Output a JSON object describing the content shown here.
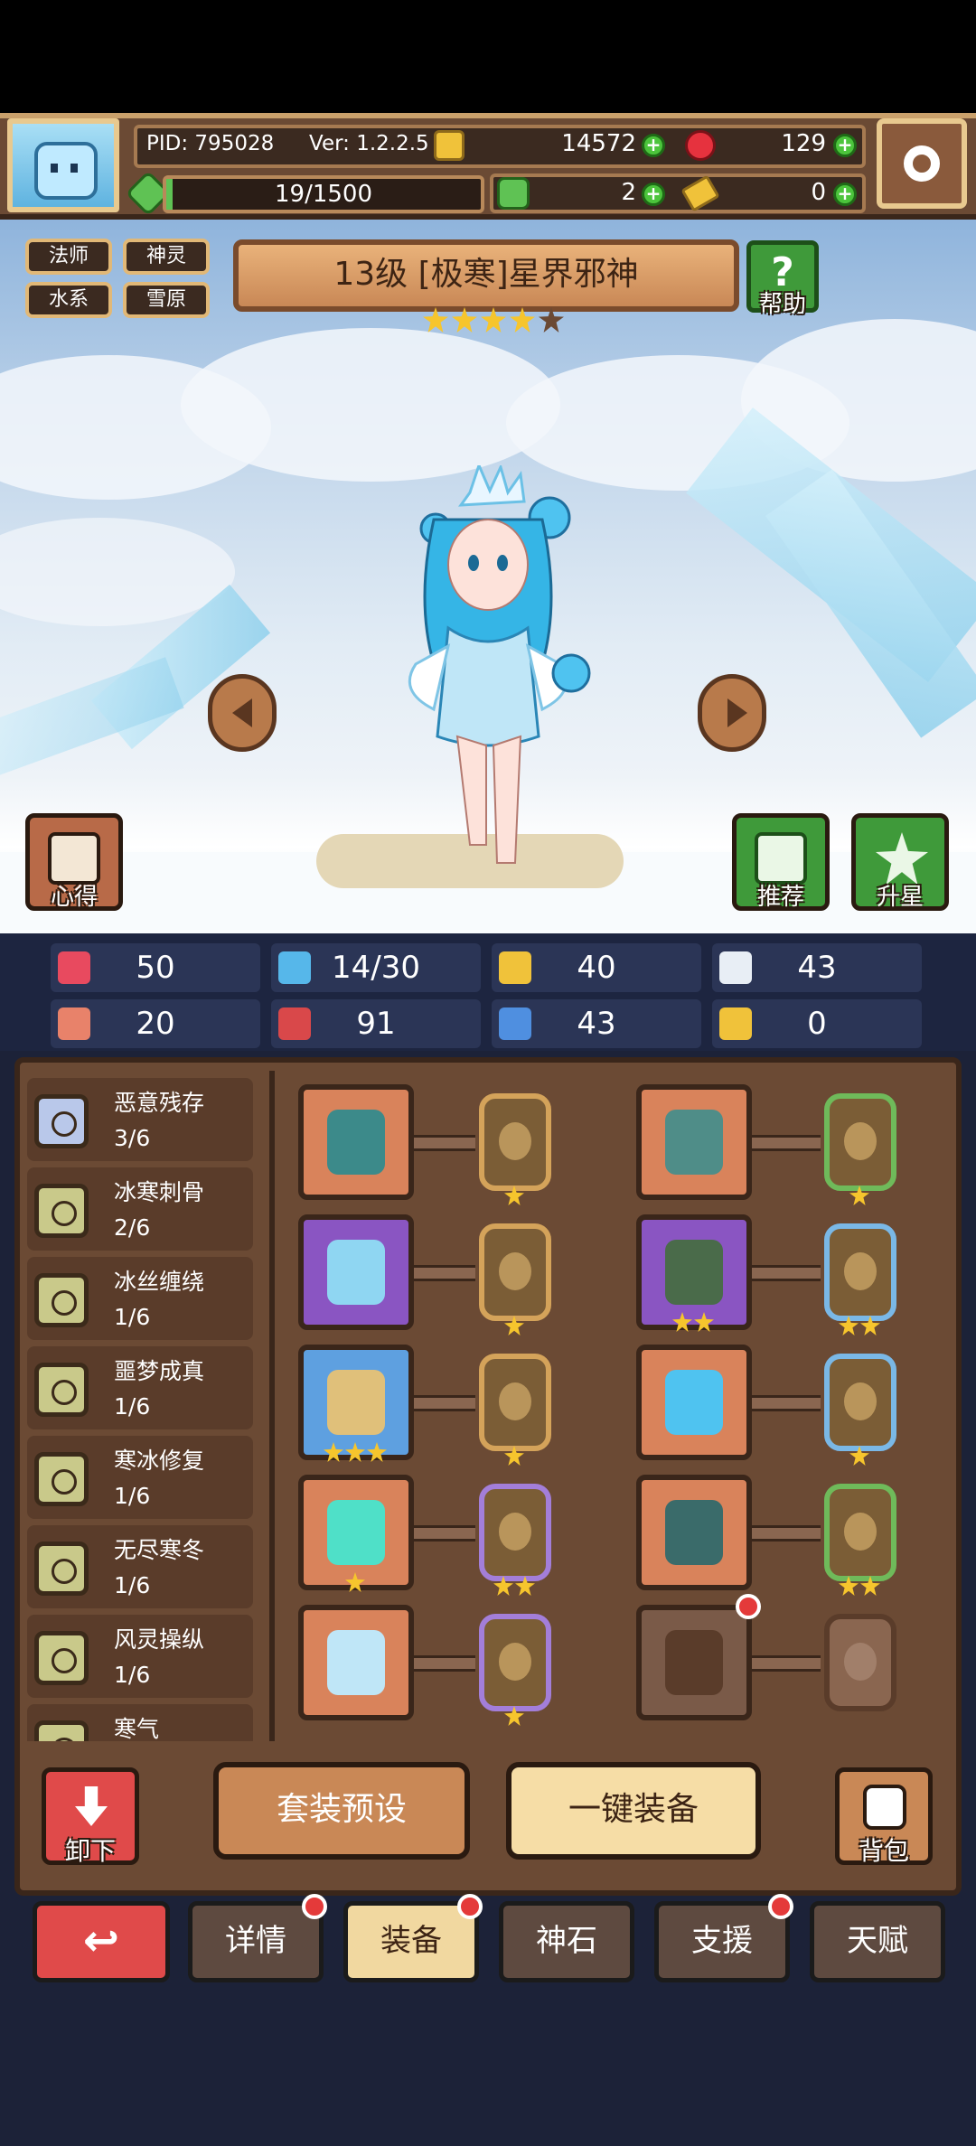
{
  "header": {
    "pid": "PID: 795028",
    "version": "Ver: 1.2.2.5",
    "gold": "14572",
    "ruby": "129",
    "xp": "19/1500",
    "clover": "2",
    "key": "0"
  },
  "hero": {
    "tags": [
      "法师",
      "神灵",
      "水系",
      "雪原"
    ],
    "title": "13级 [极寒]星界邪神",
    "stars": 4,
    "max_stars": 5,
    "help_label": "帮助",
    "xinde_label": "心得",
    "recommend_label": "推荐",
    "upgrade_label": "升星"
  },
  "stats": [
    {
      "icon": "heart-icon",
      "value": "50",
      "color": "#e84a5f"
    },
    {
      "icon": "water-drop-icon",
      "value": "14/30",
      "color": "#56b7ea"
    },
    {
      "icon": "shield-icon",
      "value": "40",
      "color": "#f0c23a"
    },
    {
      "icon": "wing-icon",
      "value": "43",
      "color": "#e8eef5"
    },
    {
      "icon": "fist-icon",
      "value": "20",
      "color": "#e8826a"
    },
    {
      "icon": "book-icon",
      "value": "91",
      "color": "#d9484a"
    },
    {
      "icon": "scroll-icon",
      "value": "43",
      "color": "#4f8fe0"
    },
    {
      "icon": "horseshoe-icon",
      "value": "0",
      "color": "#f0c23a"
    }
  ],
  "sets": [
    {
      "name": "恶意残存",
      "count": "3/6"
    },
    {
      "name": "冰寒刺骨",
      "count": "2/6"
    },
    {
      "name": "冰丝缠绕",
      "count": "1/6"
    },
    {
      "name": "噩梦成真",
      "count": "1/6"
    },
    {
      "name": "寒冰修复",
      "count": "1/6"
    },
    {
      "name": "无尽寒冬",
      "count": "1/6"
    },
    {
      "name": "风灵操纵",
      "count": "1/6"
    },
    {
      "name": "寒气",
      "count": ""
    }
  ],
  "equipment": [
    {
      "item": "staff",
      "rarity": "orange",
      "item_stars": 0,
      "rune": "gold",
      "rune_stars": 1
    },
    {
      "item": "armor",
      "rarity": "orange",
      "item_stars": 0,
      "rune": "green",
      "rune_stars": 1
    },
    {
      "item": "crown",
      "rarity": "purple",
      "item_stars": 0,
      "rune": "gold",
      "rune_stars": 1
    },
    {
      "item": "cloak",
      "rarity": "purple",
      "item_stars": 2,
      "rune": "blue",
      "rune_stars": 2
    },
    {
      "item": "necklace",
      "rarity": "blue",
      "item_stars": 3,
      "rune": "gold",
      "rune_stars": 1
    },
    {
      "item": "glove",
      "rarity": "orange",
      "item_stars": 0,
      "rune": "blue",
      "rune_stars": 1
    },
    {
      "item": "gem",
      "rarity": "orange",
      "item_stars": 1,
      "rune": "purple",
      "rune_stars": 2
    },
    {
      "item": "belt",
      "rarity": "orange",
      "item_stars": 0,
      "rune": "green",
      "rune_stars": 2
    },
    {
      "item": "ice-helm",
      "rarity": "orange",
      "item_stars": 0,
      "rune": "purple",
      "rune_stars": 1
    },
    {
      "item": "boots-empty",
      "rarity": "empty",
      "item_stars": 0,
      "rune": "empty",
      "rune_stars": 0
    }
  ],
  "actions": {
    "unequip": "卸下",
    "preset": "套装预设",
    "auto_equip": "一键装备",
    "bag": "背包"
  },
  "nav": {
    "tabs": [
      "详情",
      "装备",
      "神石",
      "支援",
      "天赋"
    ],
    "active": "装备"
  }
}
